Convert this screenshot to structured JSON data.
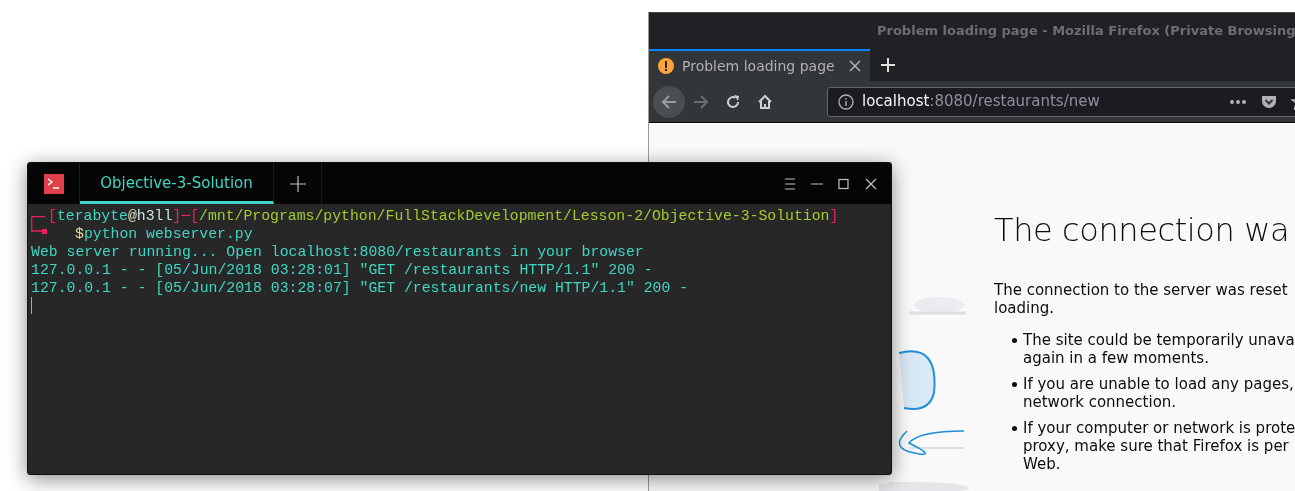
{
  "browser": {
    "title": "Problem loading page - Mozilla Firefox (Private Browsing",
    "tabs": [
      {
        "label": "Problem loading page",
        "selected": true
      }
    ],
    "url": {
      "host": "localhost",
      "rest": ":8080/restaurants/new"
    },
    "page": {
      "heading": "The connection wa",
      "intro": [
        "The connection to the server was reset",
        "loading."
      ],
      "bullets": [
        {
          "lines": [
            "The site could be temporarily unava",
            "again in a few moments."
          ]
        },
        {
          "lines": [
            "If you are unable to load any pages,",
            "network connection."
          ]
        },
        {
          "lines": [
            "If your computer or network is prote",
            "proxy, make sure that Firefox is per",
            "Web."
          ]
        }
      ]
    }
  },
  "terminal": {
    "tabs": [
      {
        "label": "Objective-3-Solution",
        "selected": true
      }
    ],
    "prompt": [
      {
        "kind": "bracket",
        "text": "["
      },
      {
        "kind": "user",
        "text": "terabyte"
      },
      {
        "kind": "at",
        "text": "@"
      },
      {
        "kind": "host",
        "text": "h3ll"
      },
      {
        "kind": "bracket",
        "text": "]"
      },
      {
        "kind": "dash",
        "text": "─"
      },
      {
        "kind": "bracket",
        "text": "["
      },
      {
        "kind": "path",
        "text": "/mnt/Programs/python/FullStackDevelopment/Lesson-2/Objective-3-Solution"
      },
      {
        "kind": "bracket",
        "text": "]"
      }
    ],
    "command": {
      "symbol": "$",
      "text": "python webserver.py"
    },
    "output": [
      "Web server running... Open localhost:8080/restaurants in your browser",
      "127.0.0.1 - - [05/Jun/2018 03:28:01] \"GET /restaurants HTTP/1.1\" 200 -",
      "127.0.0.1 - - [05/Jun/2018 03:28:07] \"GET /restaurants/new HTTP/1.1\" 200 -"
    ]
  }
}
